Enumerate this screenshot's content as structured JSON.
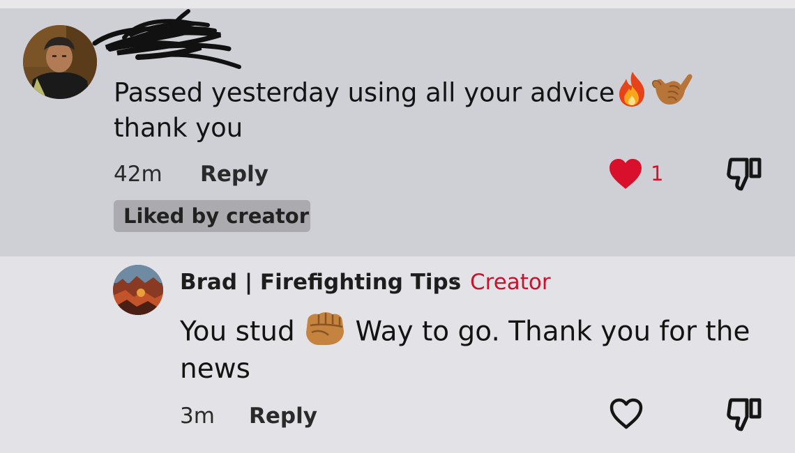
{
  "comment": {
    "text_line1": "Passed yesterday using all your advice",
    "text_line2": "thank you",
    "emojis": [
      "fire-emoji",
      "call-me-hand-emoji"
    ],
    "time": "42m",
    "reply_label": "Reply",
    "like_count": "1",
    "liked": true,
    "badge": "Liked by creator"
  },
  "reply": {
    "author": "Brad | Firefighting Tips",
    "separator": "·",
    "role": "Creator",
    "text_part1": "You stud",
    "text_part2": "Way to go. Thank you for the",
    "text_line2": "news",
    "emojis": [
      "oncoming-fist-emoji"
    ],
    "time": "3m",
    "reply_label": "Reply",
    "liked": false
  },
  "colors": {
    "highlight_bg": "#cfcfd6",
    "like_red": "#d8102c",
    "creator_red": "#c4142e",
    "badge_bg": "#aaaaaf"
  },
  "icons": [
    "heart-filled-icon",
    "thumbs-down-icon",
    "heart-outline-icon"
  ]
}
